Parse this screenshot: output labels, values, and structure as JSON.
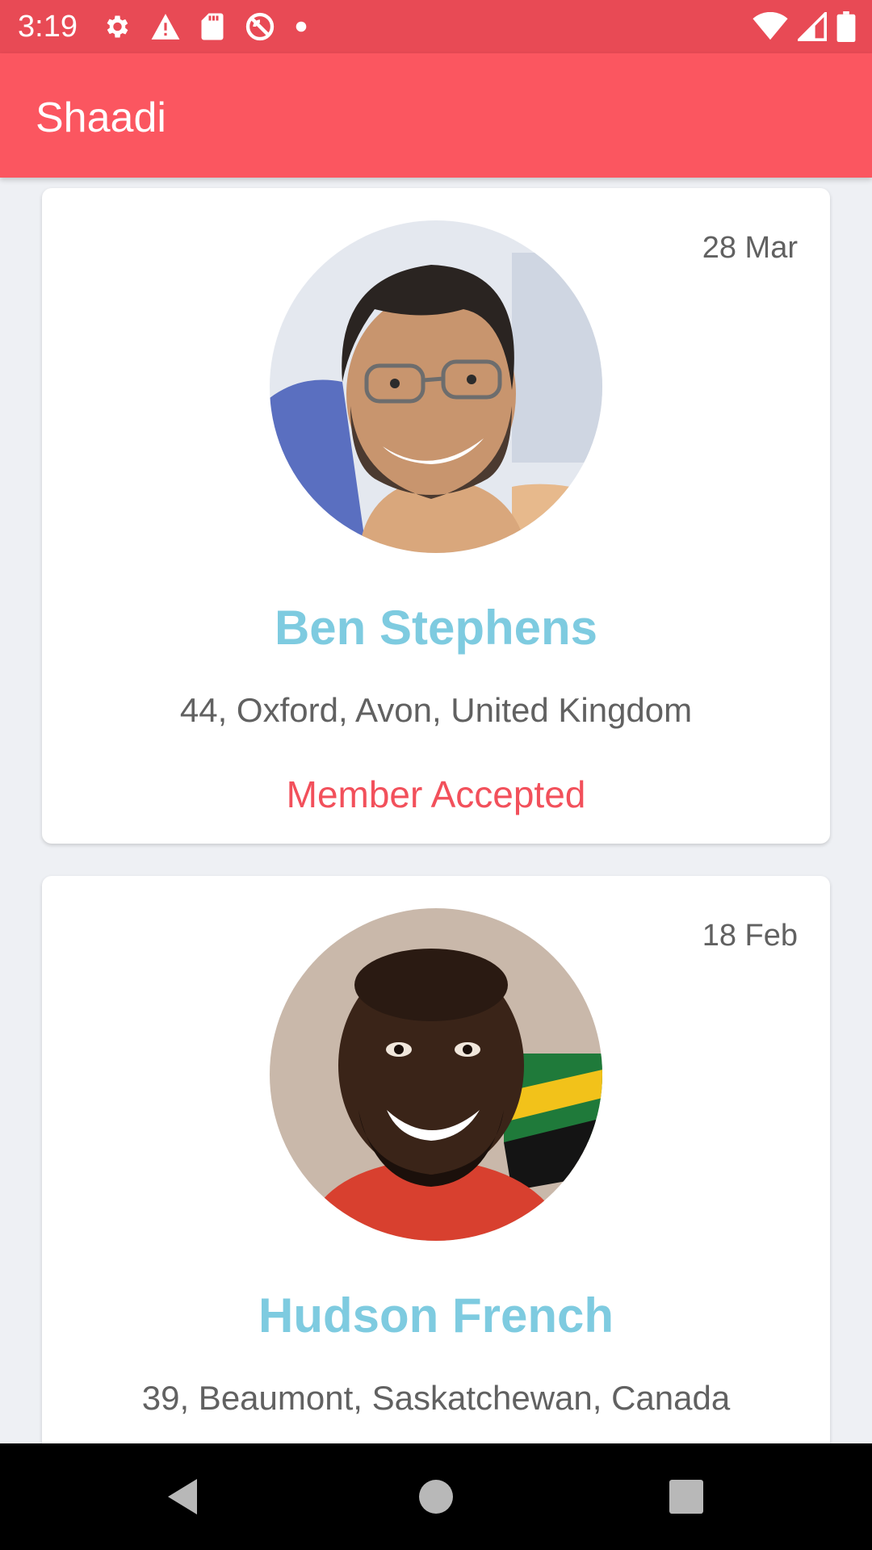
{
  "status_bar": {
    "time": "3:19",
    "left_icons": [
      "gear-icon",
      "warning-icon",
      "sd-card-icon",
      "no-disturb-icon",
      "dot-icon"
    ],
    "right_icons": [
      "wifi-icon",
      "signal-icon",
      "battery-icon"
    ],
    "background": "#e84a55"
  },
  "app_bar": {
    "title": "Shaadi",
    "background": "#fb5660"
  },
  "profiles": [
    {
      "date": "28 Mar",
      "name": "Ben Stephens",
      "details": "44, Oxford, Avon, United Kingdom",
      "status": "Member Accepted"
    },
    {
      "date": "18 Feb",
      "name": "Hudson French",
      "details": "39, Beaumont, Saskatchewan, Canada"
    }
  ],
  "colors": {
    "name": "#7ecbe0",
    "status": "#f2505b",
    "details": "#616161"
  },
  "nav_bar": {
    "buttons": [
      "back-icon",
      "home-icon",
      "recents-icon"
    ]
  }
}
